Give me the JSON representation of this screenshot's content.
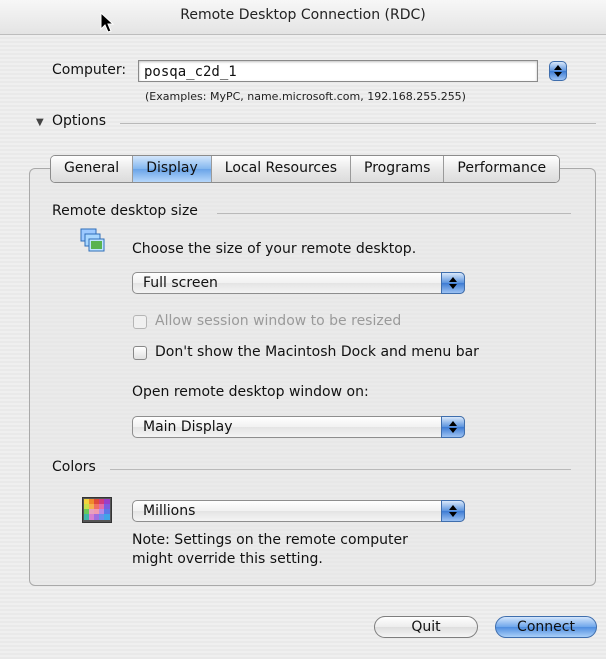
{
  "window": {
    "title": "Remote Desktop Connection (RDC)"
  },
  "computer": {
    "label": "Computer:",
    "value": "posqa_c2d_1",
    "examples": "(Examples: MyPC, name.microsoft.com, 192.168.255.255)"
  },
  "options": {
    "label": "Options",
    "expanded": true
  },
  "tabs": [
    {
      "label": "General",
      "selected": false
    },
    {
      "label": "Display",
      "selected": true
    },
    {
      "label": "Local Resources",
      "selected": false
    },
    {
      "label": "Programs",
      "selected": false
    },
    {
      "label": "Performance",
      "selected": false
    }
  ],
  "display": {
    "remote_size_header": "Remote desktop size",
    "choose_size_text": "Choose the size of your remote desktop.",
    "size_popup": "Full screen",
    "allow_resize": {
      "label": "Allow session window to be resized",
      "checked": false,
      "enabled": false
    },
    "hide_dock": {
      "label": "Don't show the Macintosh Dock and menu bar",
      "checked": false,
      "enabled": true
    },
    "open_on_label": "Open remote desktop window on:",
    "open_on_popup": "Main Display",
    "colors_header": "Colors",
    "colors_popup": "Millions",
    "note_line1": "Note: Settings on the remote computer",
    "note_line2": "might override this setting."
  },
  "buttons": {
    "quit": "Quit",
    "connect": "Connect"
  },
  "colors": {
    "accent": "#5a93de",
    "disabled_text": "#9a9a9a"
  }
}
